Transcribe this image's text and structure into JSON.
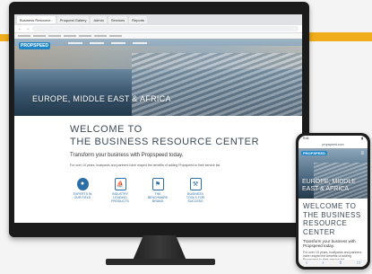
{
  "browser": {
    "tabs": [
      "Business Resource..",
      "Proquest Gallery",
      "Admin",
      "Services",
      "Reports"
    ],
    "active_tab": 0
  },
  "site": {
    "logo": "PROPSPEED",
    "hero_title": "EUROPE, MIDDLE EAST & AFRICA",
    "welcome_line1": "WELCOME TO",
    "welcome_line2": "THE BUSINESS RESOURCE CENTER",
    "tagline": "Transform your business with Propspeed today.",
    "paragraph": "For over 10 years, boatyards and partners have reaped the benefits of adding Propspeed to their service list.",
    "features": [
      {
        "icon": "pin-icon",
        "glyph": "●",
        "label": "EXPERTS IN OUR FIELD"
      },
      {
        "icon": "boat-icon",
        "glyph": "⛵",
        "label": "INDUSTRY LEADING PRODUCTS"
      },
      {
        "icon": "benchmark-icon",
        "glyph": "⚑",
        "label": "THE BENCHMARK BRAND"
      },
      {
        "icon": "tools-icon",
        "glyph": "⚒",
        "label": "BUSINESS TOOLS FOR SUCCESS"
      }
    ]
  },
  "phone": {
    "time": "9:41",
    "url": "propspeed.com",
    "hero_title_line1": "EUROPE, MIDDLE",
    "hero_title_line2": "EAST & AFRICA",
    "welcome_line1": "WELCOME TO",
    "welcome_line2": "THE BUSINESS",
    "welcome_line3": "RESOURCE",
    "welcome_line4": "CENTER",
    "tagline": "Transform your business with Propspeed today.",
    "paragraph": "For over 10 years, boatyards and partners have reaped the benefits of adding Propspeed to their service list."
  },
  "colors": {
    "accent": "#f0ad1c",
    "brand_blue": "#2c6fa6"
  }
}
